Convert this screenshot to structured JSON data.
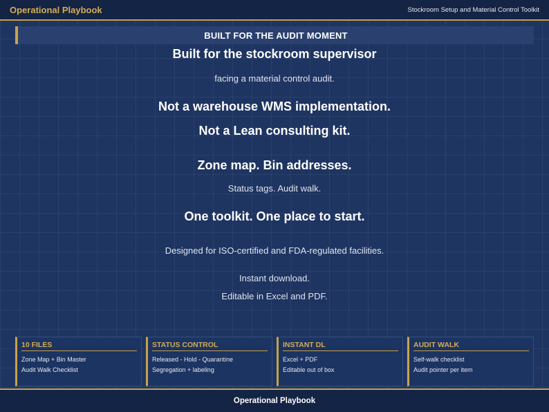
{
  "header": {
    "brand": "Operational Playbook",
    "toolkit_title": "Stockroom Setup and Material Control Toolkit"
  },
  "banner": {
    "title": "BUILT FOR THE AUDIT MOMENT"
  },
  "main": {
    "lines": [
      "Built for the stockroom supervisor",
      "facing a material control audit.",
      "Not a warehouse WMS implementation.",
      "Not a Lean consulting kit.",
      "Zone map. Bin addresses.",
      "Status tags. Audit walk.",
      "One toolkit. One place to start.",
      "Designed for ISO-certified and FDA-regulated facilities.",
      "Instant download.",
      "Editable in Excel and PDF."
    ]
  },
  "cards": [
    {
      "title": "10 FILES",
      "lines": [
        "Zone Map + Bin Master",
        "Audit Walk Checklist"
      ]
    },
    {
      "title": "STATUS CONTROL",
      "lines": [
        "Released - Hold - Quarantine",
        "Segregation + labeling"
      ]
    },
    {
      "title": "INSTANT DL",
      "lines": [
        "Excel + PDF",
        "Editable out of box"
      ]
    },
    {
      "title": "AUDIT WALK",
      "lines": [
        "Self-walk checklist",
        "Audit pointer per item"
      ]
    }
  ],
  "footer": {
    "brand": "Operational Playbook"
  },
  "colors": {
    "accent": "#c9a24a",
    "background": "#1e3461",
    "bar": "#142445"
  }
}
